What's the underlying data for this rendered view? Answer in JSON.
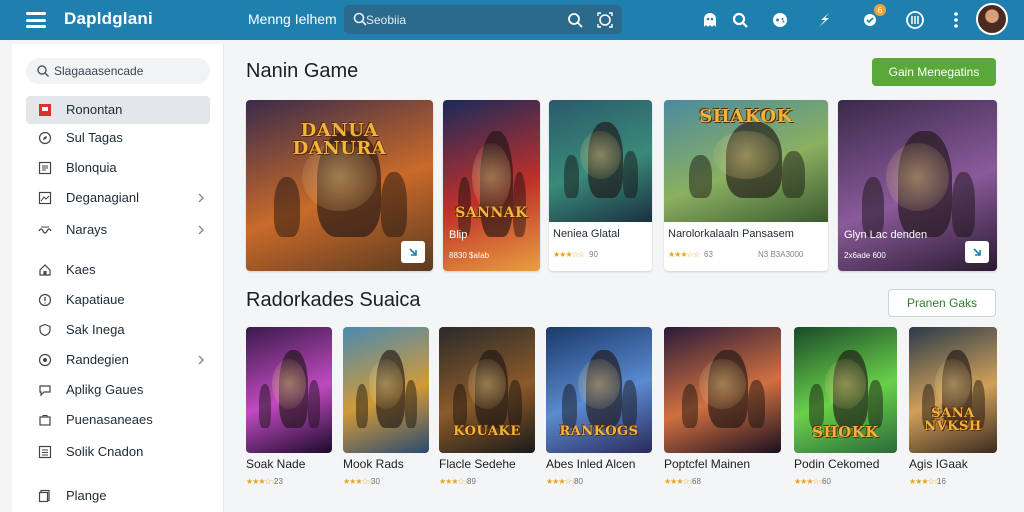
{
  "header": {
    "brand": "Dapldglani",
    "nav_link": "Menng Ielhem",
    "search_placeholder": "Seobiia",
    "icons": [
      "menu-icon",
      "search-icon",
      "scan-icon",
      "ghost-icon",
      "search-alt-icon",
      "controller-icon",
      "bolt-icon",
      "notification-icon",
      "support-icon",
      "more-icon"
    ],
    "notification_count": "6",
    "brand_color": "#1f7fae"
  },
  "sidebar": {
    "search_placeholder": "Slagaaasencade",
    "items": [
      {
        "label": "Ronontan",
        "icon": "flag-icon",
        "active": true,
        "chevron": false
      },
      {
        "label": "Sul Tagas",
        "icon": "compass-icon",
        "active": false,
        "chevron": false
      },
      {
        "label": "Blonquia",
        "icon": "grid-icon",
        "active": false,
        "chevron": false
      },
      {
        "label": "Deganagianl",
        "icon": "image-icon",
        "active": false,
        "chevron": true
      },
      {
        "label": "Narays",
        "icon": "wave-icon",
        "active": false,
        "chevron": true
      },
      {
        "label": "Kaes",
        "icon": "home-icon",
        "active": false,
        "chevron": false
      },
      {
        "label": "Kapatiaue",
        "icon": "info-icon",
        "active": false,
        "chevron": false
      },
      {
        "label": "Sak Inega",
        "icon": "shield-icon",
        "active": false,
        "chevron": false
      },
      {
        "label": "Randegien",
        "icon": "target-icon",
        "active": false,
        "chevron": true
      },
      {
        "label": "Aplikg Gaues",
        "icon": "chat-icon",
        "active": false,
        "chevron": false
      },
      {
        "label": "Puenasaneaes",
        "icon": "bag-icon",
        "active": false,
        "chevron": false
      },
      {
        "label": "Solik Cnadon",
        "icon": "list-icon",
        "active": false,
        "chevron": false
      },
      {
        "label": "Plange",
        "icon": "copy-icon",
        "active": false,
        "chevron": false
      }
    ]
  },
  "main_games": {
    "title": "Nanin Game",
    "button": "Gain Menegatins",
    "cards": [
      {
        "logo": "DANUA\nDANURA",
        "name": "",
        "sub": "",
        "rating": "",
        "download": true,
        "theme": [
          "#3a2b4a",
          "#c96a2a",
          "#5a3a20"
        ]
      },
      {
        "logo": "SANNAK",
        "name": "Blip",
        "sub": "8830 $aIab",
        "rating": "",
        "download": false,
        "theme": [
          "#1a2a5a",
          "#c0302a",
          "#e8a040"
        ]
      },
      {
        "logo": "",
        "name": "Neniea Glatal",
        "sub": "",
        "rating": "90",
        "download": false,
        "theme": [
          "#2a5a6a",
          "#3a8a7a",
          "#1a3040"
        ]
      },
      {
        "logo": "SHAKOK",
        "name": "Narolorkalaaln Pansasem",
        "sub": "",
        "rating": "63",
        "extra": "N3 B3A3000",
        "download": false,
        "theme": [
          "#4a8aa0",
          "#8ab060",
          "#3a5a30"
        ]
      },
      {
        "logo": "",
        "name": "Glyn Lac denden",
        "sub": "2x6ade 600",
        "rating": "",
        "download": true,
        "theme": [
          "#3a2a4a",
          "#8a5a9a",
          "#2a1a30"
        ]
      }
    ]
  },
  "recommended": {
    "title": "Radorkades Suaica",
    "button": "Pranen Gaks",
    "cards": [
      {
        "name": "Soak Nade",
        "rating": "23",
        "logo": "",
        "theme": [
          "#3a1a4a",
          "#c04ac0",
          "#1a0a2a"
        ]
      },
      {
        "name": "Mook Rads",
        "rating": "30",
        "logo": "",
        "theme": [
          "#4a8ab0",
          "#d09a3a",
          "#2a4a70"
        ]
      },
      {
        "name": "Flacle Sedehe",
        "rating": "89",
        "logo": "KOUAKE",
        "theme": [
          "#2a2a2a",
          "#8a5a2a",
          "#1a1a1a"
        ]
      },
      {
        "name": "Abes Inled Alcen",
        "rating": "80",
        "logo": "RANKOGS",
        "theme": [
          "#1a3a6a",
          "#5a8ad0",
          "#2a2a5a"
        ]
      },
      {
        "name": "Poptcfel Mainen",
        "rating": "68",
        "logo": "",
        "theme": [
          "#2a1a3a",
          "#d07040",
          "#1a1020"
        ]
      },
      {
        "name": "Podin Cekomed",
        "rating": "60",
        "logo": "SHOKK",
        "theme": [
          "#1a4a2a",
          "#6ad04a",
          "#2a6a3a"
        ]
      },
      {
        "name": "Agis IGaak",
        "rating": "16",
        "logo": "SANA\nNVKSH",
        "theme": [
          "#2a3a4a",
          "#d0a05a",
          "#3a2a20"
        ]
      }
    ]
  }
}
